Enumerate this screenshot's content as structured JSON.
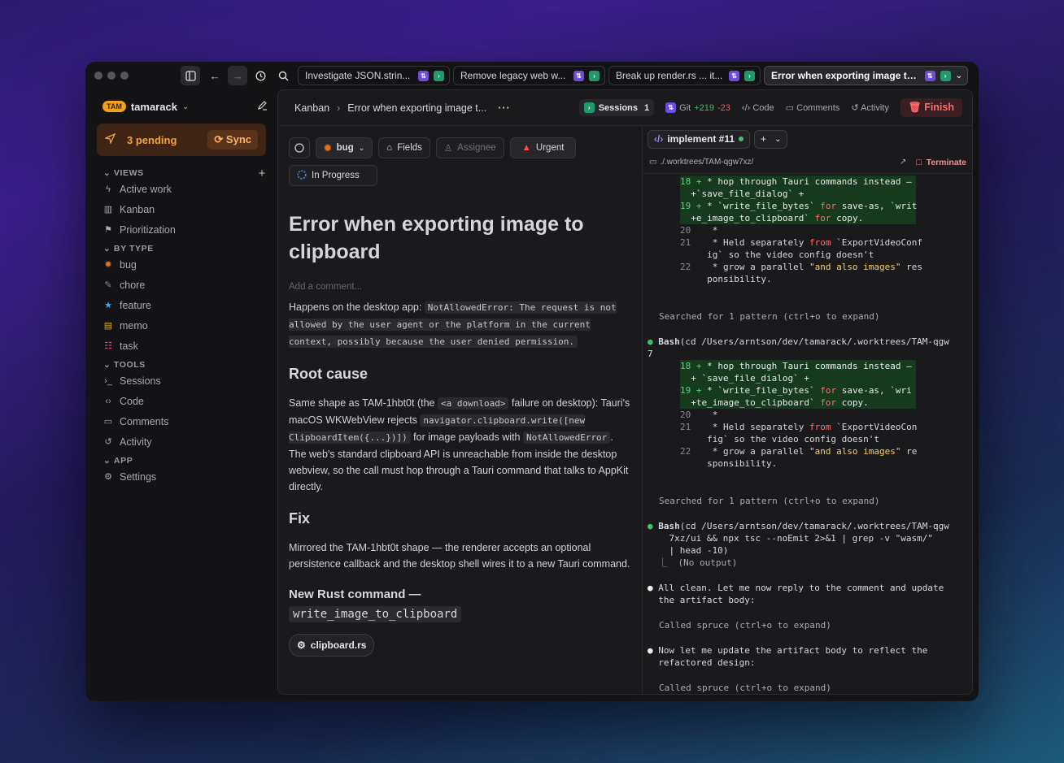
{
  "tabs": [
    {
      "label": "Investigate JSON.strin..."
    },
    {
      "label": "Remove legacy web w..."
    },
    {
      "label": "Break up render.rs ... it..."
    },
    {
      "label": "Error when exporting image to..."
    }
  ],
  "sidebar": {
    "workspace_badge": "TAM",
    "workspace_name": "tamarack",
    "pending_label": "3 pending",
    "sync_label": "Sync",
    "views_heading": "VIEWS",
    "views": [
      {
        "label": "Active work",
        "icon": "lightning-icon"
      },
      {
        "label": "Kanban",
        "icon": "kanban-icon"
      },
      {
        "label": "Prioritization",
        "icon": "flag-icon"
      }
    ],
    "by_type_heading": "BY TYPE",
    "types": [
      {
        "label": "bug",
        "icon": "bug-icon",
        "color": "#e8701a"
      },
      {
        "label": "chore",
        "icon": "wrench-icon",
        "color": "#8a8a92"
      },
      {
        "label": "feature",
        "icon": "star-icon",
        "color": "#3ab0e8"
      },
      {
        "label": "memo",
        "icon": "memo-icon",
        "color": "#e8a81a"
      },
      {
        "label": "task",
        "icon": "task-icon",
        "color": "#e84a8a"
      }
    ],
    "tools_heading": "TOOLS",
    "tools": [
      {
        "label": "Sessions",
        "icon": "terminal-icon"
      },
      {
        "label": "Code",
        "icon": "code-icon"
      },
      {
        "label": "Comments",
        "icon": "comment-icon"
      },
      {
        "label": "Activity",
        "icon": "history-icon"
      }
    ],
    "app_heading": "APP",
    "app": [
      {
        "label": "Settings",
        "icon": "gear-icon"
      }
    ]
  },
  "header": {
    "crumb_root": "Kanban",
    "crumb_current": "Error when exporting image t...",
    "sessions_label": "Sessions",
    "sessions_count": "1",
    "git_label": "Git",
    "git_add": "+219",
    "git_del": "-23",
    "code_label": "Code",
    "comments_label": "Comments",
    "activity_label": "Activity",
    "finish_label": "Finish"
  },
  "issue": {
    "type_label": "bug",
    "fields_label": "Fields",
    "assignee_label": "Assignee",
    "priority_label": "Urgent",
    "status_label": "In Progress",
    "title": "Error when exporting image to clipboard",
    "add_comment_placeholder": "Add a comment...",
    "p1_pre": "Happens on the desktop app: ",
    "p1_code": "NotAllowedError: The request is not allowed by the user agent or the platform in the current context, possibly because the user denied permission.",
    "h_root": "Root cause",
    "p2_a": "Same shape as TAM-1hbt0t (the ",
    "p2_code1": "<a download>",
    "p2_b": " failure on desktop): Tauri's macOS WKWebView rejects ",
    "p2_code2": "navigator.clipboard.write([new ClipboardItem({...})])",
    "p2_c": " for image payloads with ",
    "p2_code3": "NotAllowedError",
    "p2_d": ". The web's standard clipboard API is unreachable from inside the desktop webview, so the call must hop through a Tauri command that talks to AppKit directly.",
    "h_fix": "Fix",
    "p3": "Mirrored the TAM-1hbt0t shape — the renderer accepts an optional persistence callback and the desktop shell wires it to a new Tauri command.",
    "h_cmd": "New Rust command —",
    "h_cmd_code": "write_image_to_clipboard",
    "file_chip": "clipboard.rs"
  },
  "session": {
    "tab_label": "implement #11",
    "path": "./.worktrees/TAM-qgw7xz/",
    "terminate_label": "Terminate",
    "search1": "Searched for 1 pattern (ctrl+o to expand)",
    "bash1": "(cd /Users/arntson/dev/tamarack/.worktrees/TAM-qgw\n7",
    "search2": "Searched for 1 pattern (ctrl+o to expand)",
    "bash2": "(cd /Users/arntson/dev/tamarack/.worktrees/TAM-qgw\n    7xz/ui && npx tsc --noEmit 2>&1 | grep -v \"wasm/\"\n    | head -10)",
    "no_output": "  ⎿  (No output)",
    "msg1": "All clean. Let me now reply to the comment and update\n  the artifact body:",
    "called1": "Called spruce (ctrl+o to expand)",
    "msg2": "Now let me update the artifact body to reflect the\n  refactored design:",
    "called2": "Called spruce (ctrl+o to expand)",
    "bash_label": "Bash"
  },
  "colors": {
    "accent_orange": "#f0a21a",
    "urgent_red": "#ff4d4d",
    "finish_red": "#ff6a6a",
    "diff_add_bg": "#163a1d"
  }
}
